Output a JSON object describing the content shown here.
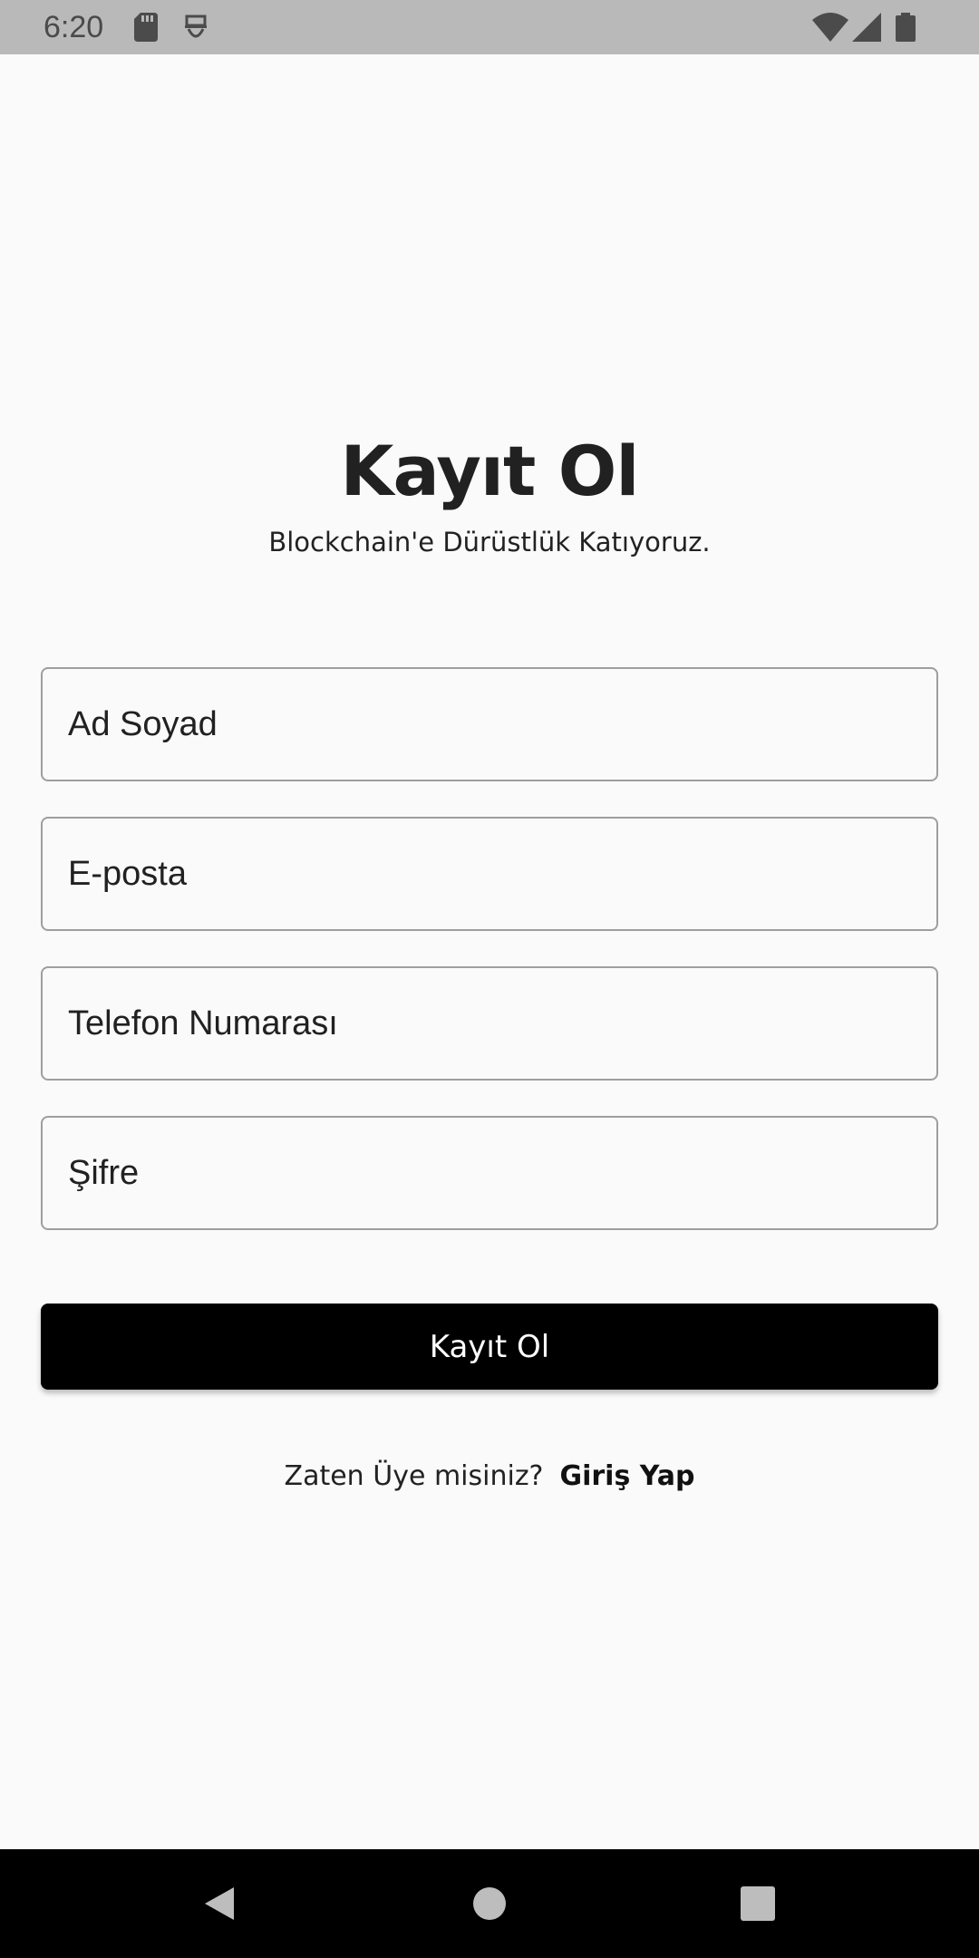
{
  "status_bar": {
    "time": "6:20",
    "icons": [
      "sd-card-icon",
      "face-icon",
      "wifi-icon",
      "signal-icon",
      "battery-icon"
    ]
  },
  "header": {
    "title": "Kayıt Ol",
    "subtitle": "Blockchain'e Dürüstlük Katıyoruz."
  },
  "form": {
    "fields": [
      {
        "placeholder": "Ad Soyad"
      },
      {
        "placeholder": "E-posta"
      },
      {
        "placeholder": "Telefon Numarası"
      },
      {
        "placeholder": "Şifre"
      }
    ],
    "submit_label": "Kayıt Ol"
  },
  "footer": {
    "prompt": "Zaten Üye misiniz?",
    "link": "Giriş Yap"
  },
  "colors": {
    "status_bar_bg": "#b9b9b9",
    "background": "#fafafa",
    "button_bg": "#000000",
    "button_text": "#ffffff",
    "field_border": "#9e9e9e",
    "nav_bar_bg": "#000000"
  },
  "nav_bar": {
    "icons": [
      "back-icon",
      "home-icon",
      "recents-icon"
    ]
  }
}
